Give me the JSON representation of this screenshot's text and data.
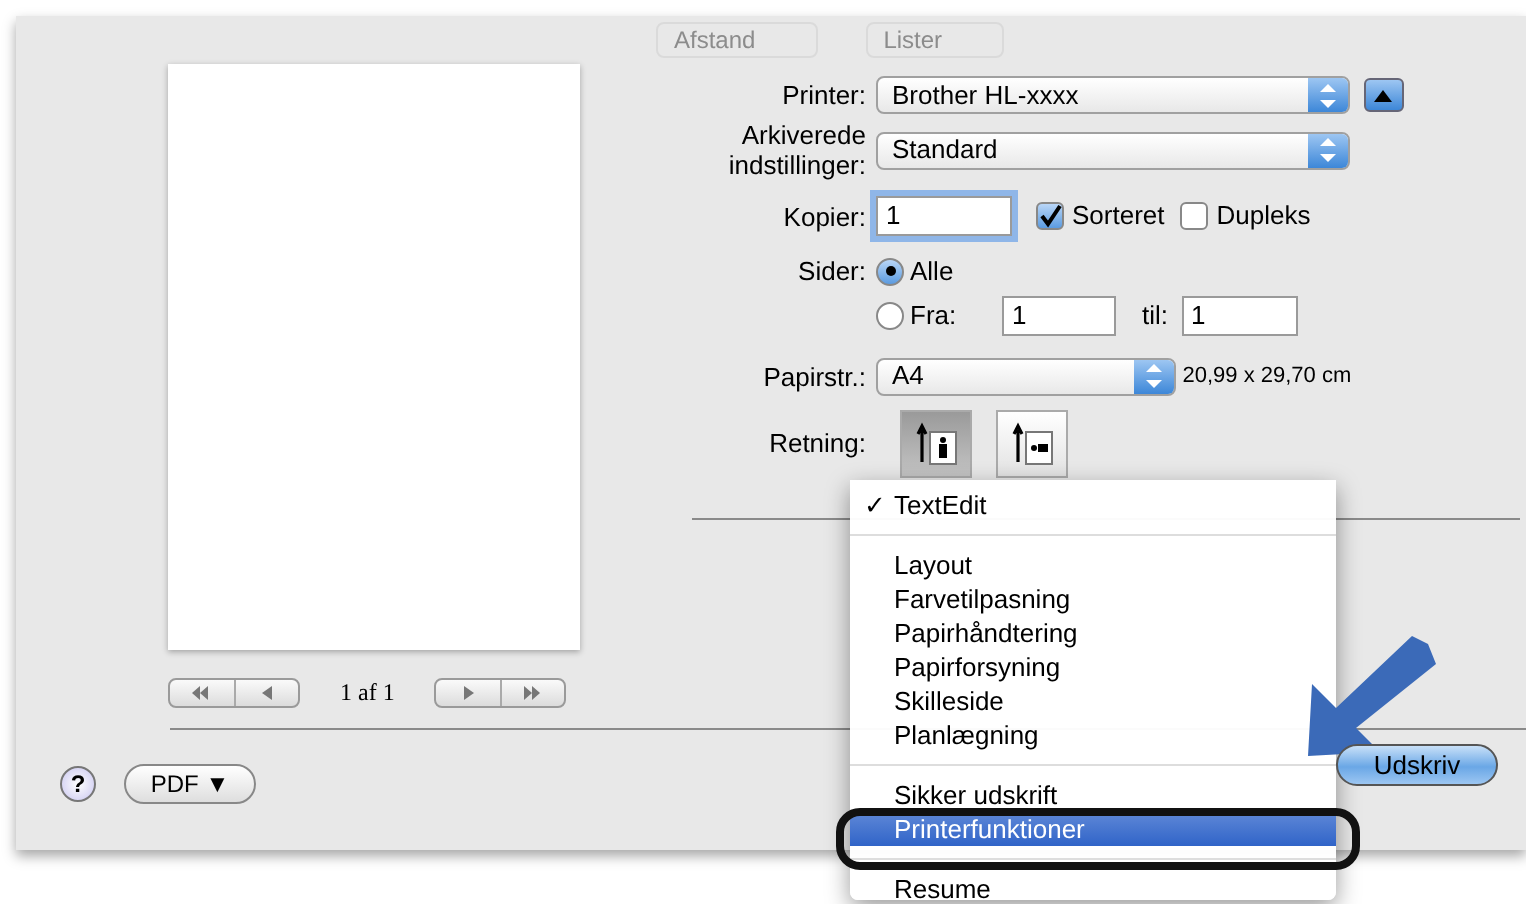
{
  "toolbar": {
    "items": [
      {
        "label": "Afstand"
      },
      {
        "label": "Lister"
      }
    ]
  },
  "preview": {
    "page_label": "1 af 1"
  },
  "settings": {
    "printer": {
      "label": "Printer:",
      "value": "Brother HL-xxxx"
    },
    "presets": {
      "label": "Arkiverede indstillinger:",
      "value": "Standard"
    },
    "copies": {
      "label": "Kopier:",
      "value": "1"
    },
    "collated": {
      "label": "Sorteret",
      "checked": true
    },
    "duplex": {
      "label": "Dupleks",
      "checked": false
    },
    "pages": {
      "label": "Sider:",
      "options": [
        {
          "label": "Alle",
          "selected": true
        },
        {
          "label": "Fra:",
          "selected": false
        }
      ],
      "from": "1",
      "to_label": "til:",
      "to": "1"
    },
    "paper_size": {
      "label": "Papirstr.:",
      "value": "A4",
      "dimensions": "20,99 x 29,70 cm"
    },
    "orientation": {
      "label": "Retning:",
      "options": [
        {
          "kind": "portrait",
          "selected": true
        },
        {
          "kind": "landscape",
          "selected": false
        }
      ]
    }
  },
  "menu": {
    "check_mark": "✓",
    "groups": [
      [
        {
          "label": "TextEdit",
          "checked": true,
          "selected": false
        }
      ],
      [
        {
          "label": "Layout",
          "checked": false,
          "selected": false
        },
        {
          "label": "Farvetilpasning",
          "checked": false,
          "selected": false
        },
        {
          "label": "Papirhåndtering",
          "checked": false,
          "selected": false
        },
        {
          "label": "Papirforsyning",
          "checked": false,
          "selected": false
        },
        {
          "label": "Skilleside",
          "checked": false,
          "selected": false
        },
        {
          "label": "Planlægning",
          "checked": false,
          "selected": false
        }
      ],
      [
        {
          "label": "Sikker udskrift",
          "checked": false,
          "selected": false
        },
        {
          "label": "Printerfunktioner",
          "checked": false,
          "selected": true
        }
      ],
      [
        {
          "label": "Resume",
          "checked": false,
          "selected": false
        }
      ]
    ]
  },
  "footer": {
    "help": "?",
    "pdf": "PDF ▼",
    "print": "Udskriv"
  }
}
